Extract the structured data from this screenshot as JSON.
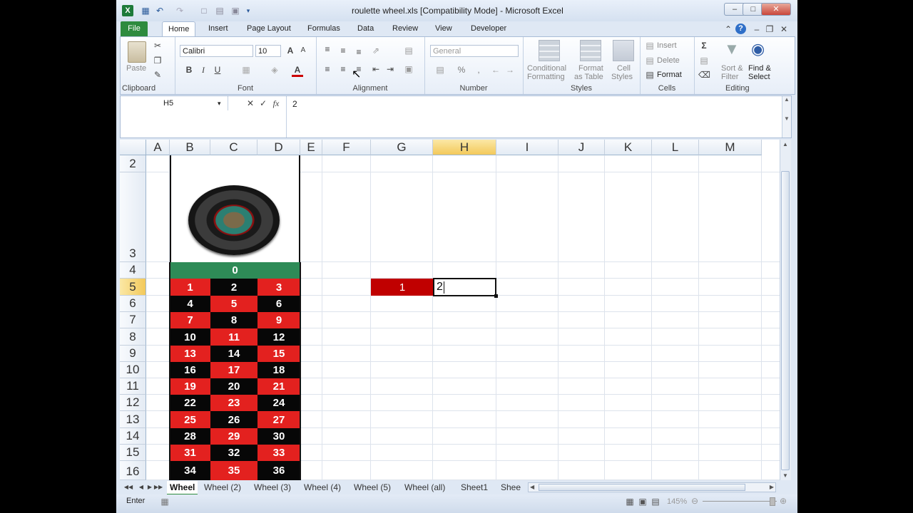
{
  "window": {
    "title": "roulette wheel.xls  [Compatibility Mode]  -  Microsoft Excel"
  },
  "tabs": [
    "File",
    "Home",
    "Insert",
    "Page Layout",
    "Formulas",
    "Data",
    "Review",
    "View",
    "Developer"
  ],
  "ribbon": {
    "clipboard": {
      "label": "Clipboard",
      "paste": "Paste"
    },
    "font": {
      "label": "Font",
      "family": "Calibri",
      "size": "10",
      "bold": "B",
      "italic": "I",
      "underline": "U"
    },
    "alignment": {
      "label": "Alignment"
    },
    "number": {
      "label": "Number",
      "format": "General",
      "percent": "%",
      "comma": ","
    },
    "styles": {
      "label": "Styles",
      "conditional_1": "Conditional",
      "conditional_2": "Formatting",
      "format_table_1": "Format",
      "format_table_2": "as Table",
      "cell_styles_1": "Cell",
      "cell_styles_2": "Styles"
    },
    "cells": {
      "label": "Cells",
      "insert": "Insert",
      "delete": "Delete",
      "format": "Format"
    },
    "editing": {
      "label": "Editing",
      "sort_1": "Sort &",
      "sort_2": "Filter",
      "find_1": "Find &",
      "find_2": "Select"
    }
  },
  "formula_bar": {
    "name_box": "H5",
    "fx": "fx",
    "value": "2"
  },
  "columns": [
    "A",
    "B",
    "C",
    "D",
    "E",
    "F",
    "G",
    "H",
    "I",
    "J",
    "K",
    "L",
    "M"
  ],
  "rows": [
    "2",
    "3",
    "4",
    "5",
    "6",
    "7",
    "8",
    "9",
    "10",
    "11",
    "12",
    "13",
    "14",
    "15",
    "16"
  ],
  "wheel": {
    "zero": "0",
    "numbers": [
      [
        "1",
        "2",
        "3"
      ],
      [
        "4",
        "5",
        "6"
      ],
      [
        "7",
        "8",
        "9"
      ],
      [
        "10",
        "11",
        "12"
      ],
      [
        "13",
        "14",
        "15"
      ],
      [
        "16",
        "17",
        "18"
      ],
      [
        "19",
        "20",
        "21"
      ],
      [
        "22",
        "23",
        "24"
      ],
      [
        "25",
        "26",
        "27"
      ],
      [
        "28",
        "29",
        "30"
      ],
      [
        "31",
        "32",
        "33"
      ],
      [
        "34",
        "35",
        "36"
      ]
    ]
  },
  "g5_value": "1",
  "h5_value": "2",
  "sheet_tabs": [
    "Wheel",
    "Wheel (2)",
    "Wheel (3)",
    "Wheel (4)",
    "Wheel (5)",
    "Wheel (all)",
    "Sheet1",
    "Shee"
  ],
  "status": {
    "mode": "Enter",
    "zoom": "145%"
  },
  "colors": {
    "red": "#e3211f",
    "black": "#070707",
    "green": "#2e8b57",
    "g5_red": "#c00000"
  }
}
